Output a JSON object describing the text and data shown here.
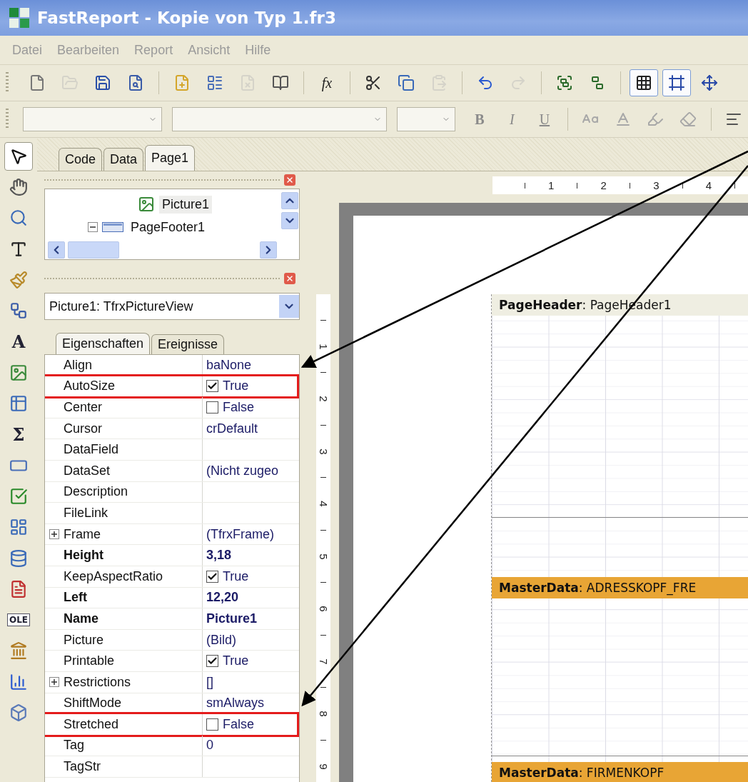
{
  "window": {
    "title": "FastReport - Kopie von Typ 1.fr3"
  },
  "menu": [
    "Datei",
    "Bearbeiten",
    "Report",
    "Ansicht",
    "Hilfe"
  ],
  "toolbar": [
    {
      "kind": "button",
      "disabled": false,
      "selected": false
    },
    {
      "kind": "button",
      "disabled": true,
      "selected": false
    },
    {
      "kind": "button",
      "disabled": false,
      "selected": false
    },
    {
      "kind": "button",
      "disabled": false,
      "selected": false
    },
    {
      "kind": "separator"
    },
    {
      "kind": "button",
      "disabled": false,
      "selected": false
    },
    {
      "kind": "button",
      "disabled": false,
      "selected": false
    },
    {
      "kind": "button",
      "disabled": true,
      "selected": false
    },
    {
      "kind": "button",
      "disabled": false,
      "selected": false
    },
    {
      "kind": "separator"
    },
    {
      "kind": "text",
      "label": "fx",
      "disabled": false,
      "selected": false
    },
    {
      "kind": "separator"
    },
    {
      "kind": "button",
      "disabled": false,
      "selected": false
    },
    {
      "kind": "button",
      "disabled": false,
      "selected": false
    },
    {
      "kind": "button",
      "disabled": true,
      "selected": false
    },
    {
      "kind": "separator"
    },
    {
      "kind": "button",
      "disabled": false,
      "selected": false
    },
    {
      "kind": "button",
      "disabled": true,
      "selected": false
    },
    {
      "kind": "separator"
    },
    {
      "kind": "button",
      "disabled": false,
      "selected": false
    },
    {
      "kind": "button",
      "disabled": false,
      "selected": false
    },
    {
      "kind": "separator"
    },
    {
      "kind": "button",
      "disabled": false,
      "selected": true
    },
    {
      "kind": "button",
      "disabled": false,
      "selected": true
    },
    {
      "kind": "button",
      "disabled": false,
      "selected": false
    }
  ],
  "format_bar": [
    {
      "kind": "text",
      "label": "B",
      "disabled": true
    },
    {
      "kind": "text",
      "label": "I",
      "disabled": true
    },
    {
      "kind": "text",
      "label": "U",
      "disabled": true
    },
    {
      "kind": "separator"
    },
    {
      "kind": "button",
      "disabled": true
    },
    {
      "kind": "button",
      "disabled": true
    },
    {
      "kind": "button",
      "disabled": true
    },
    {
      "kind": "button",
      "disabled": true
    },
    {
      "kind": "separator"
    },
    {
      "kind": "button",
      "disabled": false
    }
  ],
  "tools": [
    {
      "selected": true
    },
    {
      "selected": false
    },
    {
      "selected": false
    },
    {
      "selected": false
    },
    {
      "selected": false
    },
    {
      "selected": false
    },
    {
      "label": "A",
      "selected": false
    },
    {
      "selected": false
    },
    {
      "selected": false
    },
    {
      "label": "Σ",
      "selected": false
    },
    {
      "selected": false
    },
    {
      "selected": false
    },
    {
      "selected": false
    },
    {
      "selected": false
    },
    {
      "selected": false
    },
    {
      "label": "OLE",
      "selected": false
    },
    {
      "selected": false
    },
    {
      "selected": false
    },
    {
      "selected": false
    }
  ],
  "page_tabs": [
    {
      "label": "Code",
      "selected": false
    },
    {
      "label": "Data",
      "selected": false
    },
    {
      "label": "Page1",
      "selected": true
    }
  ],
  "tree": {
    "nodes": [
      {
        "children": [
          {
            "label": "Picture1",
            "kind": "picture",
            "selected": true
          }
        ]
      },
      {
        "label": "PageFooter1",
        "kind": "band",
        "selected": false,
        "expanded": true
      }
    ]
  },
  "object_selector": {
    "value": "Picture1: TfrxPictureView"
  },
  "inspector_tabs": [
    {
      "label": "Eigenschaften",
      "selected": true
    },
    {
      "label": "Ereignisse",
      "selected": false
    }
  ],
  "properties": [
    {
      "name": "Align",
      "kind": "text",
      "value": "baNone",
      "modified": false,
      "highlighted": false
    },
    {
      "name": "AutoSize",
      "kind": "checkbox",
      "value": "True",
      "checked": true,
      "modified": false,
      "highlighted": true
    },
    {
      "name": "Center",
      "kind": "checkbox",
      "value": "False",
      "checked": false,
      "modified": false,
      "highlighted": false
    },
    {
      "name": "Cursor",
      "kind": "text",
      "value": "crDefault",
      "modified": false,
      "highlighted": false
    },
    {
      "name": "DataField",
      "kind": "text",
      "modified": false,
      "highlighted": false
    },
    {
      "name": "DataSet",
      "kind": "text",
      "value": "(Nicht zugeo",
      "modified": false,
      "highlighted": false
    },
    {
      "name": "Description",
      "kind": "text",
      "modified": false,
      "highlighted": false
    },
    {
      "name": "FileLink",
      "kind": "text",
      "modified": false,
      "highlighted": false
    },
    {
      "name": "Frame",
      "kind": "text",
      "value": "(TfrxFrame)",
      "expanded": false,
      "modified": false,
      "highlighted": false
    },
    {
      "name": "Height",
      "kind": "text",
      "value": "3,18",
      "modified": true,
      "highlighted": false
    },
    {
      "name": "KeepAspectRatio",
      "kind": "checkbox",
      "value": "True",
      "checked": true,
      "modified": false,
      "highlighted": false
    },
    {
      "name": "Left",
      "kind": "text",
      "value": "12,20",
      "modified": true,
      "highlighted": false
    },
    {
      "name": "Name",
      "kind": "text",
      "value": "Picture1",
      "modified": true,
      "highlighted": false
    },
    {
      "name": "Picture",
      "kind": "text",
      "value": "(Bild)",
      "modified": false,
      "highlighted": false
    },
    {
      "name": "Printable",
      "kind": "checkbox",
      "value": "True",
      "checked": true,
      "modified": false,
      "highlighted": false
    },
    {
      "name": "Restrictions",
      "kind": "text",
      "value": "[]",
      "expanded": false,
      "modified": false,
      "highlighted": false
    },
    {
      "name": "ShiftMode",
      "kind": "text",
      "value": "smAlways",
      "modified": false,
      "highlighted": false
    },
    {
      "name": "Stretched",
      "kind": "checkbox",
      "value": "False",
      "checked": false,
      "modified": false,
      "highlighted": true
    },
    {
      "name": "Tag",
      "kind": "text",
      "value": "0",
      "modified": false,
      "highlighted": false
    },
    {
      "name": "TagStr",
      "kind": "text",
      "modified": false,
      "highlighted": false
    }
  ],
  "rulers": {
    "horizontal": [
      "1",
      "2",
      "3",
      "4"
    ],
    "vertical": [
      "1",
      "2",
      "3",
      "4",
      "5",
      "6",
      "7",
      "8",
      "9"
    ]
  },
  "bands": [
    {
      "kind": "page-header",
      "title": "**PageHeader**: PageHeader1"
    },
    {
      "kind": "master-data",
      "title": "**MasterData**: ADRESSKOPF_FRE"
    },
    {
      "kind": "master-data",
      "title": "**MasterData**: FIRMENKOPF"
    }
  ]
}
